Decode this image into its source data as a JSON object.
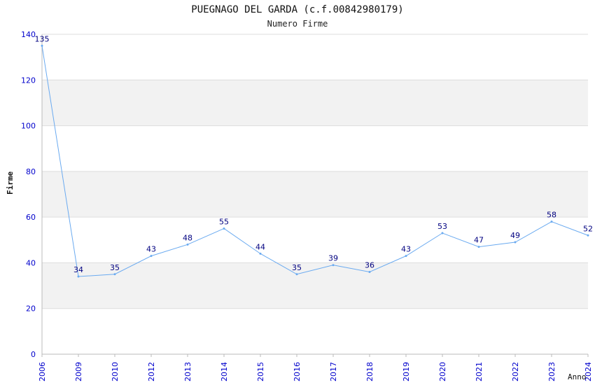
{
  "chart_data": {
    "type": "line",
    "title": "PUEGNAGO DEL GARDA (c.f.00842980179)",
    "subtitle": "Numero Firme",
    "xlabel": "Anno",
    "ylabel": "Firme",
    "ylim": [
      0,
      140
    ],
    "yticks": [
      0,
      20,
      40,
      60,
      80,
      100,
      120,
      140
    ],
    "categories": [
      "2006",
      "2009",
      "2010",
      "2012",
      "2013",
      "2014",
      "2015",
      "2016",
      "2017",
      "2018",
      "2019",
      "2020",
      "2021",
      "2022",
      "2023",
      "2024"
    ],
    "values": [
      135,
      34,
      35,
      43,
      48,
      55,
      44,
      35,
      39,
      36,
      43,
      53,
      47,
      49,
      58,
      52
    ],
    "grid": true,
    "colors": {
      "line": "#6aaaf0",
      "label": "#000080",
      "tick": "#0000cc",
      "band": "#f2f2f2",
      "grid": "#dddddd",
      "axis": "#bbbbbb"
    }
  }
}
